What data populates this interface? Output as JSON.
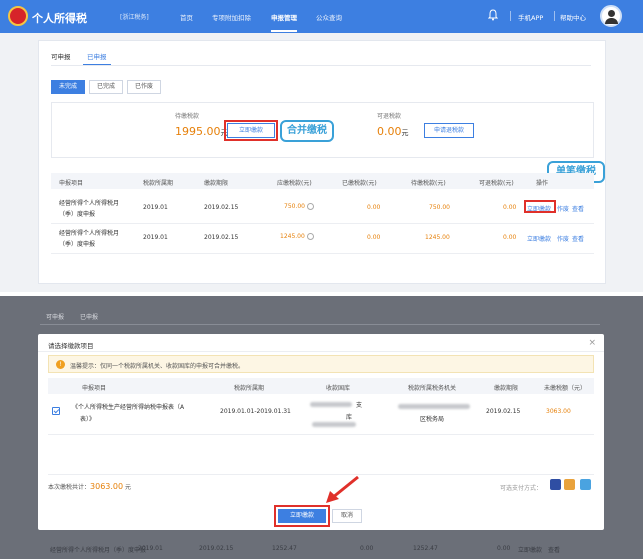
{
  "header": {
    "logo": "个人所得税",
    "region": "[浙江税务]",
    "nav": [
      "首页",
      "专项附加扣除",
      "申报管理",
      "公众查询"
    ],
    "active_nav": "申报管理",
    "app_link": "手机APP",
    "help_link": "帮助中心",
    "accent": "#3d7fe1"
  },
  "tabs": [
    "可申报",
    "已申报"
  ],
  "active_tab": "已申报",
  "status_tabs": [
    "未完成",
    "已完成",
    "已作废"
  ],
  "active_status": "未完成",
  "summary": {
    "due_label": "待缴税款",
    "due_amount": "1995.00",
    "unit": "元",
    "pay_now_button": "立即缴款",
    "refund_label": "可退税款",
    "refund_amount": "0.00",
    "refund_button": "申请退税款"
  },
  "callouts": {
    "merge": "合并缴税",
    "single": "单笔缴税"
  },
  "table": {
    "headers": [
      "申报项目",
      "税款所属期",
      "缴款期限",
      "应缴税款(元)",
      "已缴税款(元)",
      "待缴税款(元)",
      "可退税款(元)",
      "操作"
    ],
    "rows": [
      {
        "item_line1": "经营所得个人所得税月",
        "item_line2": "（季）度申报",
        "period": "2019.01",
        "deadline": "2019.02.15",
        "payable": "750.00",
        "paid": "0.00",
        "pending": "750.00",
        "refundable": "0.00",
        "op_pay": "立即缴款",
        "op_void": "作废",
        "op_view": "查看"
      },
      {
        "item_line1": "经营所得个人所得税月",
        "item_line2": "（季）度申报",
        "period": "2019.01",
        "deadline": "2019.02.15",
        "payable": "1245.00",
        "paid": "0.00",
        "pending": "1245.00",
        "refundable": "0.00",
        "op_pay": "立即缴款",
        "op_void": "作废",
        "op_view": "查看"
      }
    ]
  },
  "background": {
    "tabs": [
      "可申报",
      "已申报"
    ],
    "row": {
      "item": "经营所得个人所得税月（季）度申报",
      "period": "2019.01",
      "deadline": "2019.02.15",
      "payable": "1252.47",
      "paid": "0.00",
      "pending": "1252.47",
      "refundable": "0.00",
      "op_pay": "立即缴款",
      "op_view": "查看"
    }
  },
  "modal": {
    "title": "请选择缴款项目",
    "notice": "温馨提示：仅同一个税款所属机关、收款国库的申报可合并缴税。",
    "headers": [
      "申报项目",
      "税款所属期",
      "收款国库",
      "税款所属税务机关",
      "缴款期限",
      "未缴税额（元）"
    ],
    "row": {
      "item_line1": "《个人所得税生产经营所得纳税申报表（A",
      "item_line2": "表）》",
      "period": "2019.01.01-2019.01.31",
      "treasury_suffix1": "支",
      "treasury_suffix2": "库",
      "authority_suffix": "区税务局",
      "deadline": "2019.02.15",
      "unpaid": "3063.00"
    },
    "total_label": "本次缴税共计：",
    "total_amount": "3063.00",
    "total_unit": "元",
    "payment_label": "可选支付方式：",
    "confirm_button": "立即缴款",
    "cancel_button": "取消"
  }
}
